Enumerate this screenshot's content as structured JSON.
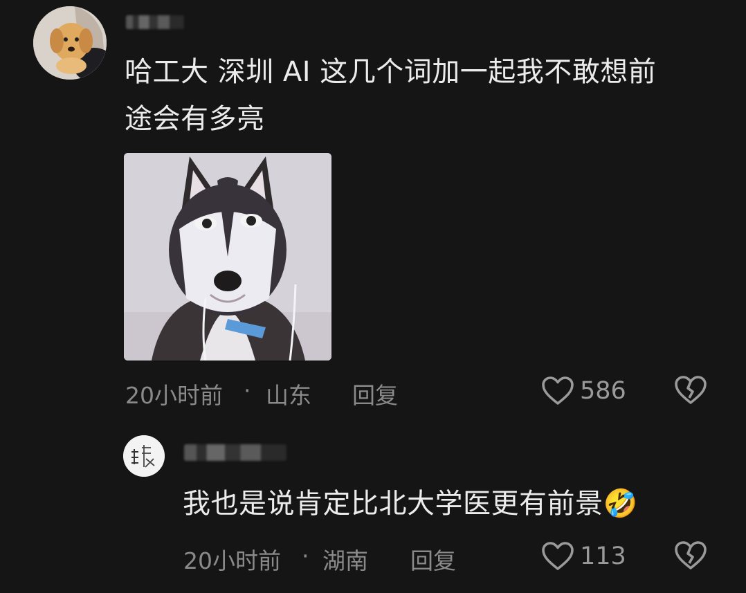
{
  "comment": {
    "avatar_icon": "puppy-avatar-icon",
    "text": "哈工大 深圳 AI 这几个词加一起我不敢想前途会有多亮",
    "text_line1": "哈工大 深圳 AI 这几个词加一起我不敢想前",
    "text_line2": "途会有多亮",
    "image_icon": "husky-meme-image",
    "time": "20小时前",
    "separator": "·",
    "location": "山东",
    "reply_label": "回复",
    "like_icon": "heart-outline-icon",
    "like_count": "586",
    "dislike_icon": "broken-heart-icon"
  },
  "reply": {
    "avatar_icon": "calligraphy-avatar-icon",
    "text": "我也是说肯定比北大学医更有前景",
    "emoji": "🤣",
    "time": "20小时前",
    "separator": "·",
    "location": "湖南",
    "reply_label": "回复",
    "like_icon": "heart-outline-icon",
    "like_count": "113",
    "dislike_icon": "broken-heart-icon"
  },
  "colors": {
    "background": "#151515",
    "text": "#ececec",
    "meta": "#8a8a8a"
  }
}
